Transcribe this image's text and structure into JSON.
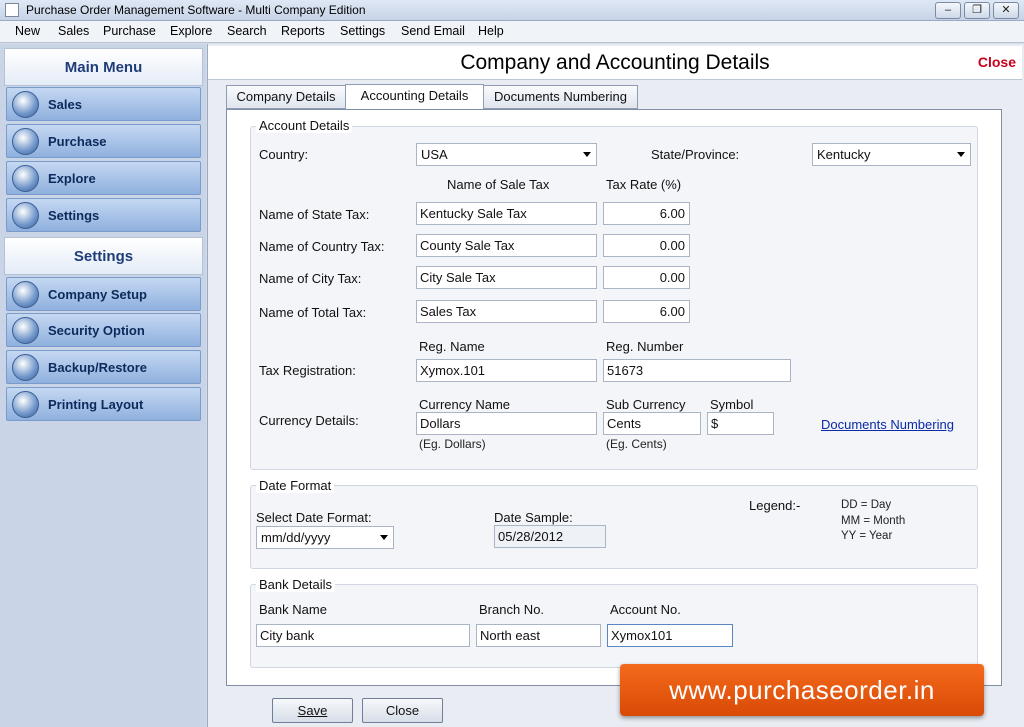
{
  "window": {
    "title": "Purchase Order Management Software - Multi Company Edition"
  },
  "menu": [
    "New",
    "Sales",
    "Purchase",
    "Explore",
    "Search",
    "Reports",
    "Settings",
    "Send Email",
    "Help"
  ],
  "sidebar": {
    "main_title": "Main Menu",
    "main_items": [
      "Sales",
      "Purchase",
      "Explore",
      "Settings"
    ],
    "settings_title": "Settings",
    "settings_items": [
      "Company Setup",
      "Security Option",
      "Backup/Restore",
      "Printing Layout"
    ]
  },
  "page": {
    "title": "Company and Accounting Details",
    "close": "Close"
  },
  "tabs": [
    "Company Details",
    "Accounting Details",
    "Documents Numbering"
  ],
  "account": {
    "group_label": "Account Details",
    "country_label": "Country:",
    "country_value": "USA",
    "state_label": "State/Province:",
    "state_value": "Kentucky",
    "col_tax_name": "Name of Sale Tax",
    "col_tax_rate": "Tax Rate (%)",
    "state_tax_label": "Name of State Tax:",
    "state_tax_name": "Kentucky Sale Tax",
    "state_tax_rate": "6.00",
    "country_tax_label": "Name of Country Tax:",
    "country_tax_name": "County Sale Tax",
    "country_tax_rate": "0.00",
    "city_tax_label": "Name of City Tax:",
    "city_tax_name": "City Sale Tax",
    "city_tax_rate": "0.00",
    "total_tax_label": "Name of Total Tax:",
    "total_tax_name": "Sales Tax",
    "total_tax_rate": "6.00",
    "tax_reg_label": "Tax Registration:",
    "reg_name_label": "Reg. Name",
    "reg_name_value": "Xymox.101",
    "reg_number_label": "Reg. Number",
    "reg_number_value": "51673",
    "currency_label": "Currency Details:",
    "currency_name_label": "Currency Name",
    "currency_name_value": "Dollars",
    "currency_name_hint": "(Eg. Dollars)",
    "sub_currency_label": "Sub Currency",
    "sub_currency_value": "Cents",
    "sub_currency_hint": "(Eg. Cents)",
    "symbol_label": "Symbol",
    "symbol_value": "$",
    "doc_numbering_link": "Documents Numbering"
  },
  "date": {
    "group_label": "Date Format",
    "select_label": "Select Date Format:",
    "select_value": "mm/dd/yyyy",
    "sample_label": "Date Sample:",
    "sample_value": "05/28/2012",
    "legend_label": "Legend:-",
    "legend_dd": "DD = Day",
    "legend_mm": "MM = Month",
    "legend_yy": "YY = Year"
  },
  "bank": {
    "group_label": "Bank Details",
    "bank_name_label": "Bank Name",
    "bank_name_value": "City bank",
    "branch_label": "Branch No.",
    "branch_value": "North east",
    "account_label": "Account No.",
    "account_value": "Xymox101"
  },
  "buttons": {
    "save": "Save",
    "close": "Close"
  },
  "watermark": "www.purchaseorder.in"
}
